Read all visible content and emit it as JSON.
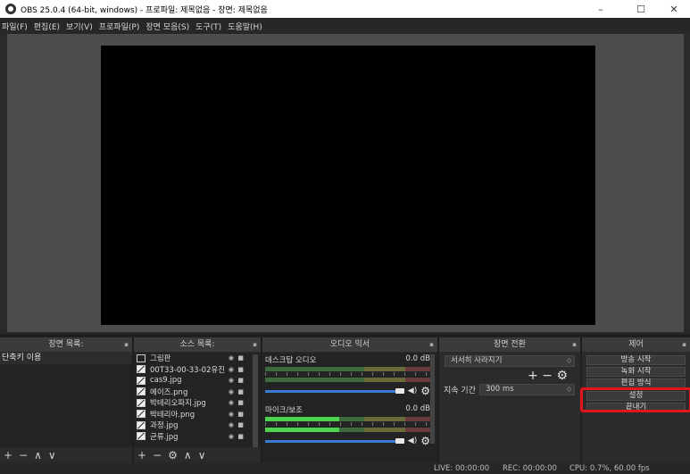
{
  "window": {
    "title": "OBS 25.0.4 (64-bit, windows) - 프로파일: 제목없음 - 장면: 제목없음",
    "minimize": "–",
    "maximize": "☐",
    "close": "✕"
  },
  "menu": [
    "파일(F)",
    "편집(E)",
    "보기(V)",
    "프로파일(P)",
    "장면 모음(S)",
    "도구(T)",
    "도움말(H)"
  ],
  "docks": {
    "scenes": {
      "title": "장면 목록:",
      "items": [
        "단축키 이용"
      ],
      "footer": [
        "+",
        "−",
        "∧",
        "∨"
      ]
    },
    "sources": {
      "title": "소스 목록:",
      "items": [
        {
          "name": "그림판",
          "icon": "window-icon"
        },
        {
          "name": "00T33-00-33-02유진",
          "icon": "image-icon"
        },
        {
          "name": "cas9.jpg",
          "icon": "image-icon"
        },
        {
          "name": "에이즈.png",
          "icon": "image-icon"
        },
        {
          "name": "박테리오파지.jpg",
          "icon": "image-icon"
        },
        {
          "name": "박테리아.png",
          "icon": "image-icon"
        },
        {
          "name": "과정.jpg",
          "icon": "image-icon"
        },
        {
          "name": "균류.jpg",
          "icon": "image-icon"
        }
      ],
      "footer": [
        "+",
        "−",
        "⚙",
        "∧",
        "∨"
      ]
    },
    "mixer": {
      "title": "오디오 믹서",
      "channels": [
        {
          "name": "데스크탑 오디오",
          "db": "0.0 dB"
        },
        {
          "name": "마이크/보조",
          "db": "0.0 dB"
        }
      ]
    },
    "transitions": {
      "title": "장면 전환",
      "selected": "서서히 사라지기",
      "duration_label": "지속 기간",
      "duration_value": "300 ms",
      "add": "+",
      "remove": "−"
    },
    "controls": {
      "title": "제어",
      "buttons": [
        "방송 시작",
        "녹화 시작",
        "편집 방식",
        "설정",
        "끝내기"
      ]
    }
  },
  "status": {
    "live": "LIVE: 00:00:00",
    "rec": "REC: 00:00:00",
    "cpu": "CPU: 0.7%, 60.00 fps"
  },
  "colors": {
    "highlight": "#e0161c"
  }
}
